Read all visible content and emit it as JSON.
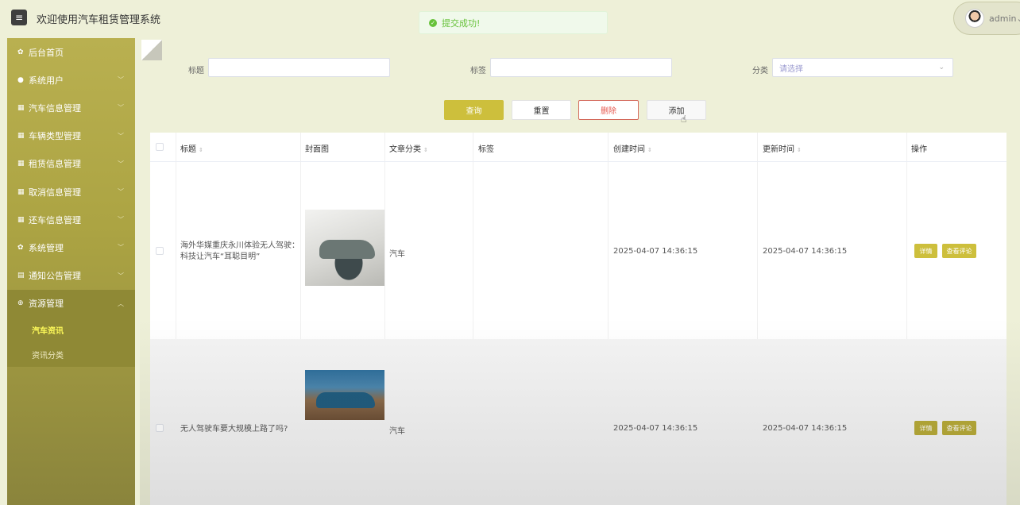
{
  "header": {
    "title": "欢迎使用汽车租赁管理系统",
    "toast": "提交成功!",
    "user": "admin"
  },
  "sidebar": {
    "items": [
      {
        "label": "后台首页",
        "icon": "gear-icon"
      },
      {
        "label": "系统用户",
        "icon": "user-icon"
      },
      {
        "label": "汽车信息管理",
        "icon": "grid-icon"
      },
      {
        "label": "车辆类型管理",
        "icon": "grid-icon"
      },
      {
        "label": "租赁信息管理",
        "icon": "grid-icon"
      },
      {
        "label": "取消信息管理",
        "icon": "grid-icon"
      },
      {
        "label": "还车信息管理",
        "icon": "grid-icon"
      },
      {
        "label": "系统管理",
        "icon": "gear-icon"
      },
      {
        "label": "通知公告管理",
        "icon": "doc-icon"
      },
      {
        "label": "资源管理",
        "icon": "plus-circle-icon"
      }
    ],
    "submenu": [
      {
        "label": "汽车资讯"
      },
      {
        "label": "资讯分类"
      }
    ]
  },
  "filters": {
    "title_label": "标题",
    "tag_label": "标签",
    "category_label": "分类",
    "category_placeholder": "请选择"
  },
  "buttons": {
    "query": "查询",
    "reset": "重置",
    "delete": "删除",
    "add": "添加"
  },
  "table": {
    "headers": {
      "title": "标题",
      "cover": "封面图",
      "category": "文章分类",
      "tag": "标签",
      "created": "创建时间",
      "updated": "更新时间",
      "actions": "操作"
    },
    "rows": [
      {
        "title": "海外华媒重庆永川体验无人驾驶：科技让汽车“耳聪目明”",
        "category": "汽车",
        "tag": "",
        "created": "2025-04-07 14:36:15",
        "updated": "2025-04-07 14:36:15",
        "detail": "详情",
        "comments": "查看评论"
      },
      {
        "title": "无人驾驶车要大规模上路了吗?",
        "category": "汽车",
        "tag": "",
        "created": "2025-04-07 14:36:15",
        "updated": "2025-04-07 14:36:15",
        "detail": "详情",
        "comments": "查看评论"
      }
    ]
  }
}
